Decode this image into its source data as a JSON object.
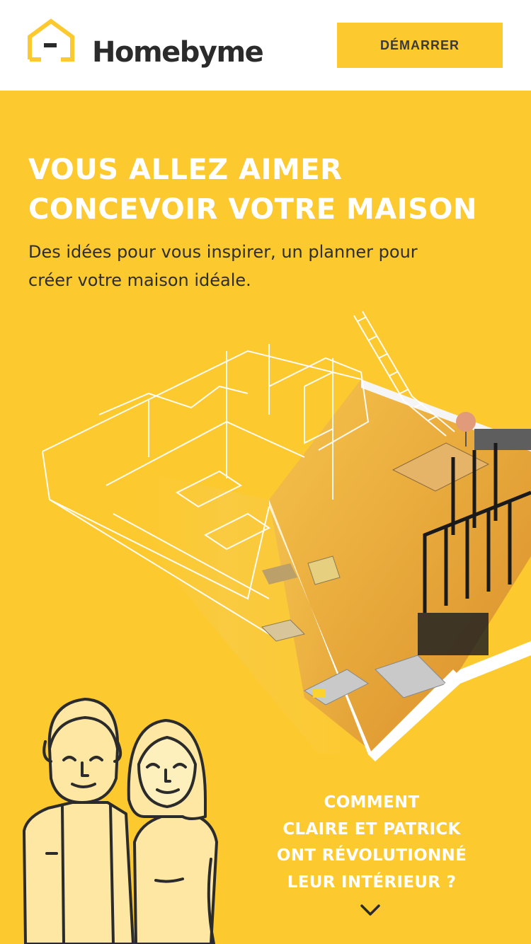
{
  "header": {
    "brand_name": "Homebyme",
    "cta_label": "DÉMARRER",
    "logo_icon": "house-outline-icon"
  },
  "hero": {
    "title_lines": [
      "VOUS ALLEZ AIMER",
      "CONCEVOIR VOTRE MAISON"
    ],
    "subtitle_lines": [
      "Des idées pour vous inspirer, un planner pour",
      "créer votre maison idéale."
    ],
    "illustration": "3d-floor-plan-illustration"
  },
  "story": {
    "lines": [
      "COMMENT",
      "CLAIRE ET PATRICK",
      "ONT RÉVOLUTIONNÉ",
      "LEUR INTÉRIEUR ?"
    ],
    "illustration": "couple-illustration",
    "scroll_icon": "chevron-down-icon"
  },
  "colors": {
    "brand_yellow": "#fcc92e",
    "text_dark": "#2b2b2b",
    "header_bg": "#ffffff"
  }
}
